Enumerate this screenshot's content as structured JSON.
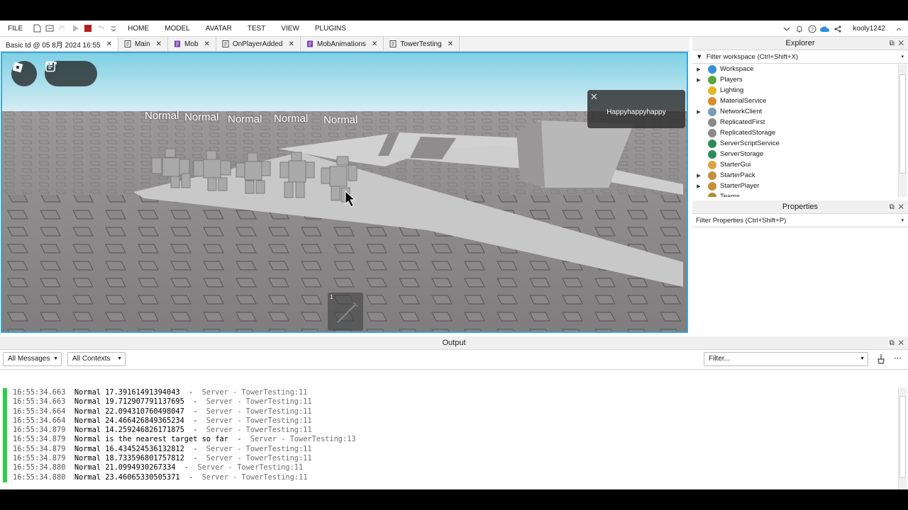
{
  "menubar": {
    "items": [
      "FILE",
      "HOME",
      "MODEL",
      "AVATAR",
      "TEST",
      "VIEW",
      "PLUGINS"
    ],
    "username": "kooly1242"
  },
  "tabs": [
    {
      "label": "Basic td @ 05 8月 2024 16:55",
      "icon": "none",
      "active": true
    },
    {
      "label": "Main",
      "icon": "script-icon",
      "active": false
    },
    {
      "label": "Mob",
      "icon": "module-script-icon",
      "active": false
    },
    {
      "label": "OnPlayerAdded",
      "icon": "script-icon",
      "active": false
    },
    {
      "label": "MobAnimations",
      "icon": "module-script-icon",
      "active": false
    },
    {
      "label": "TowerTesting",
      "icon": "script-icon",
      "active": false
    }
  ],
  "viewport": {
    "mob_labels": [
      "Normal",
      "Normal",
      "Normal",
      "Normal",
      "Normal"
    ],
    "notification_text": "Happyhappyhappy",
    "hotbar_slot": "1"
  },
  "explorer": {
    "title": "Explorer",
    "filter_placeholder": "Filter workspace (Ctrl+Shift+X)",
    "items": [
      {
        "label": "Workspace",
        "expandable": true,
        "icon": "globe-icon",
        "color": "#3b8fd6"
      },
      {
        "label": "Players",
        "expandable": true,
        "icon": "players-icon",
        "color": "#5aa63c"
      },
      {
        "label": "Lighting",
        "expandable": false,
        "icon": "lightbulb-icon",
        "color": "#e6b422"
      },
      {
        "label": "MaterialService",
        "expandable": false,
        "icon": "material-icon",
        "color": "#d98a2b"
      },
      {
        "label": "NetworkClient",
        "expandable": true,
        "icon": "network-icon",
        "color": "#7a9bb8"
      },
      {
        "label": "ReplicatedFirst",
        "expandable": false,
        "icon": "replicated-first-icon",
        "color": "#8a8a8a"
      },
      {
        "label": "ReplicatedStorage",
        "expandable": false,
        "icon": "replicated-storage-icon",
        "color": "#8a8a8a"
      },
      {
        "label": "ServerScriptService",
        "expandable": false,
        "icon": "server-script-icon",
        "color": "#2e8b57"
      },
      {
        "label": "ServerStorage",
        "expandable": false,
        "icon": "server-storage-icon",
        "color": "#2e8b57"
      },
      {
        "label": "StarterGui",
        "expandable": false,
        "icon": "folder-icon",
        "color": "#d9a441"
      },
      {
        "label": "StarterPack",
        "expandable": true,
        "icon": "folder-icon",
        "color": "#c58f3a"
      },
      {
        "label": "StarterPlayer",
        "expandable": true,
        "icon": "starter-player-icon",
        "color": "#c58f3a"
      },
      {
        "label": "Teams",
        "expandable": false,
        "icon": "teams-icon",
        "color": "#b8862b"
      }
    ]
  },
  "properties": {
    "title": "Properties",
    "filter_placeholder": "Filter Properties (Ctrl+Shift+P)"
  },
  "output": {
    "title": "Output",
    "messages_filter": "All Messages",
    "contexts_filter": "All Contexts",
    "filter_placeholder": "Filter...",
    "lines": [
      {
        "ts": "16:55:34.663",
        "msg": "Normal 17.39161491394043",
        "src": "Server - TowerTesting:11"
      },
      {
        "ts": "16:55:34.663",
        "msg": "Normal 19.712907791137695",
        "src": "Server - TowerTesting:11"
      },
      {
        "ts": "16:55:34.664",
        "msg": "Normal 22.094310760498047",
        "src": "Server - TowerTesting:11"
      },
      {
        "ts": "16:55:34.664",
        "msg": "Normal 24.466426849365234",
        "src": "Server - TowerTesting:11"
      },
      {
        "ts": "16:55:34.879",
        "msg": "Normal 14.259246826171875",
        "src": "Server - TowerTesting:11"
      },
      {
        "ts": "16:55:34.879",
        "msg": "Normal is the nearest target so far",
        "src": "Server - TowerTesting:13"
      },
      {
        "ts": "16:55:34.879",
        "msg": "Normal 16.434524536132812",
        "src": "Server - TowerTesting:11"
      },
      {
        "ts": "16:55:34.879",
        "msg": "Normal 18.733596801757812",
        "src": "Server - TowerTesting:11"
      },
      {
        "ts": "16:55:34.880",
        "msg": "Normal 21.0994930267334",
        "src": "Server - TowerTesting:11"
      },
      {
        "ts": "16:55:34.880",
        "msg": "Normal 23.46065330505371",
        "src": "Server - TowerTesting:11"
      }
    ]
  },
  "colors": {
    "accent": "#3aa4dc",
    "log_bar": "#2ecc4a",
    "stop_button": "#b71c1c"
  }
}
